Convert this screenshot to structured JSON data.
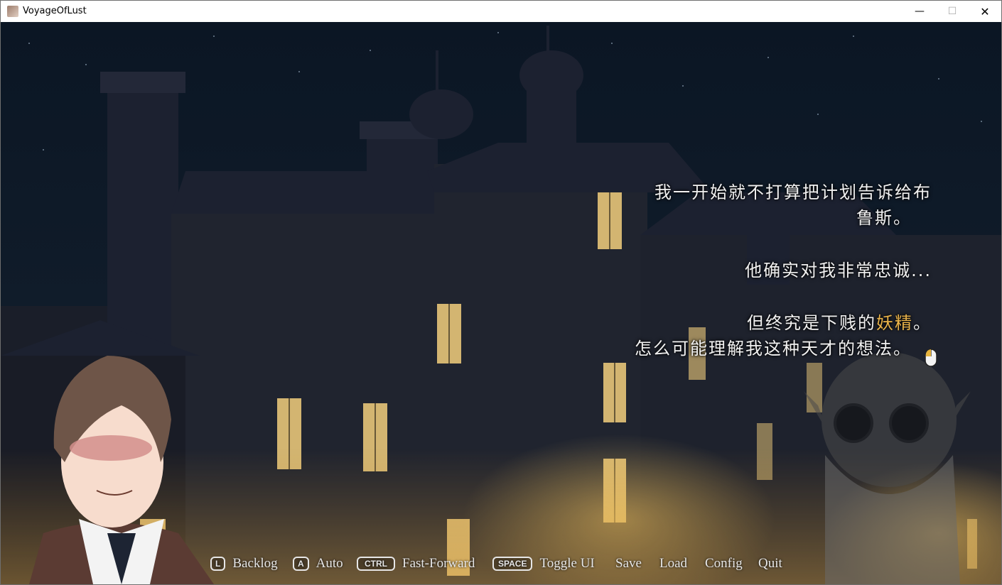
{
  "window": {
    "title": "VoyageOfLust",
    "minimize_icon": "minimize-icon",
    "maximize_icon": "maximize-icon",
    "close_icon": "close-icon",
    "minimize_glyph": "—",
    "maximize_glyph": "☐",
    "close_glyph": "✕"
  },
  "dialogue": {
    "line1": "我一开始就不打算把计划告诉给布",
    "line2": "鲁斯。",
    "line3": "他确实对我非常忠诚...",
    "line4_before": "但终究是下贱的",
    "line4_highlight": "妖精",
    "line4_after": "。",
    "line5": "怎么可能理解我这种天才的想法。",
    "highlight_color": "#e9b34a",
    "continue_icon": "mouse-click-icon"
  },
  "quick_menu": {
    "backlog": {
      "key": "L",
      "label": "Backlog"
    },
    "auto": {
      "key": "A",
      "label": "Auto"
    },
    "fast_forward": {
      "key": "CTRL",
      "label": "Fast-Forward"
    },
    "toggle_ui": {
      "key": "SPACE",
      "label": "Toggle UI"
    },
    "save": {
      "label": "Save"
    },
    "load": {
      "label": "Load"
    },
    "config": {
      "label": "Config"
    },
    "quit": {
      "label": "Quit"
    }
  }
}
